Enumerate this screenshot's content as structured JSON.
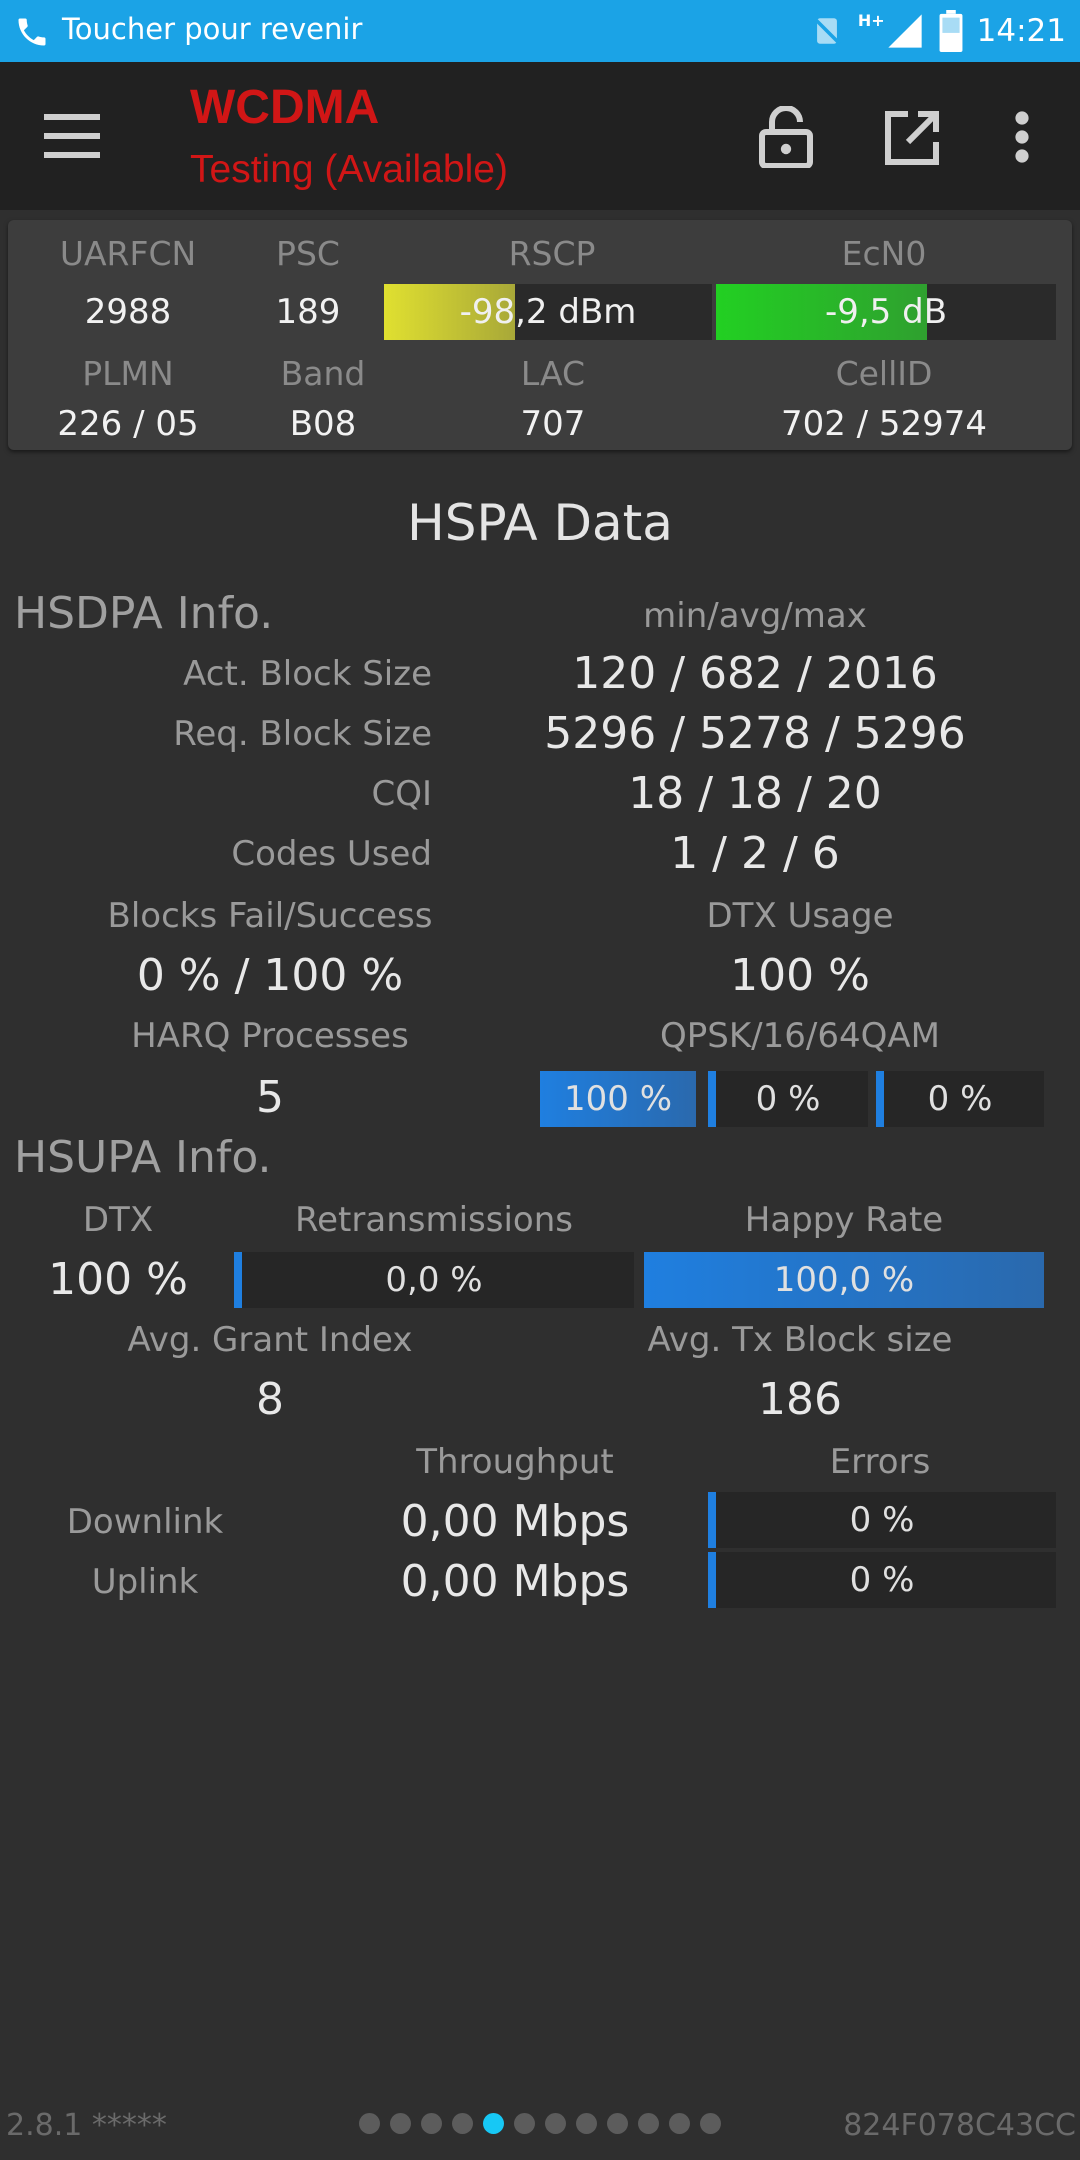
{
  "status_bar": {
    "back_text": "Toucher pour revenir",
    "network_type": "H+",
    "time": "14:21"
  },
  "app_bar": {
    "title": "WCDMA",
    "subtitle": "Testing (Available)",
    "icons": [
      "menu-icon",
      "lock-open-icon",
      "open-external-icon",
      "more-vert-icon"
    ],
    "title_color": "#d11616"
  },
  "cell": {
    "labels": {
      "uarfcn": "UARFCN",
      "psc": "PSC",
      "rscp": "RSCP",
      "ecn0": "EcN0",
      "plmn": "PLMN",
      "band": "Band",
      "lac": "LAC",
      "cellid": "CellID"
    },
    "uarfcn": "2988",
    "psc": "189",
    "rscp": "-98,2 dBm",
    "rscp_level": 0.4,
    "rscp_color": "#e0e030",
    "ecn0": "-9,5 dB",
    "ecn0_level": 0.62,
    "ecn0_color": "#22d022",
    "plmn": "226 / 05",
    "band": "B08",
    "lac": "707",
    "cellid": "702 / 52974"
  },
  "hspa": {
    "title": "HSPA Data",
    "hsdpa": {
      "heading": "HSDPA Info.",
      "col_header": "min/avg/max",
      "rows": [
        {
          "label": "Act. Block Size",
          "value": "120 / 682 / 2016"
        },
        {
          "label": "Req. Block Size",
          "value": "5296 / 5278 / 5296"
        },
        {
          "label": "CQI",
          "value": "18 / 18 / 20"
        },
        {
          "label": "Codes Used",
          "value": "1 / 2 / 6"
        }
      ],
      "blocks_label": "Blocks Fail/Success",
      "blocks_value": "0 % / 100 %",
      "dtx_label": "DTX Usage",
      "dtx_value": "100 %",
      "harq_label": "HARQ Processes",
      "harq_value": "5",
      "qam_label": "QPSK/16/64QAM",
      "qam": [
        {
          "text": "100 %",
          "level": 1.0
        },
        {
          "text": "0 %",
          "level": 0.0
        },
        {
          "text": "0 %",
          "level": 0.0
        }
      ]
    },
    "hsupa": {
      "heading": "HSUPA Info.",
      "dtx_label": "DTX",
      "dtx_value": "100 %",
      "retx_label": "Retransmissions",
      "retx_value": "0,0 %",
      "retx_level": 0.0,
      "happy_label": "Happy Rate",
      "happy_value": "100,0 %",
      "happy_level": 1.0,
      "grant_label": "Avg. Grant Index",
      "grant_value": "8",
      "txblock_label": "Avg. Tx Block size",
      "txblock_value": "186"
    },
    "throughput": {
      "throughput_header": "Throughput",
      "errors_header": "Errors",
      "downlink_label": "Downlink",
      "downlink_value": "0,00 Mbps",
      "downlink_errors": "0 %",
      "uplink_label": "Uplink",
      "uplink_value": "0,00 Mbps",
      "uplink_errors": "0 %"
    }
  },
  "footer": {
    "version": "2.8.1 *****",
    "device_id": "824F078C43CC",
    "page_count": 12,
    "active_page": 5,
    "active_dot_color": "#17c8f5"
  }
}
